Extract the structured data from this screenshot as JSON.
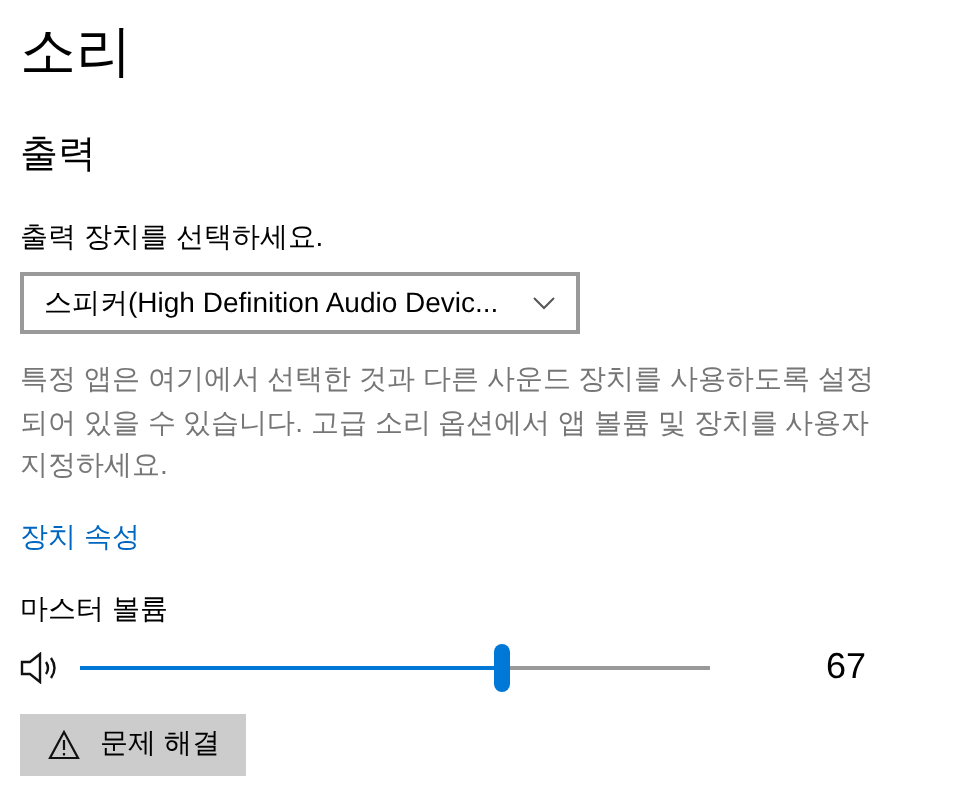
{
  "title": "소리",
  "section": "출력",
  "output_label": "출력 장치를 선택하세요.",
  "device_dropdown": {
    "value": "스피커(High Definition Audio Devic..."
  },
  "description": "특정 앱은 여기에서 선택한 것과 다른 사운드 장치를 사용하도록 설정 되어 있을 수 있습니다. 고급 소리 옵션에서 앱 볼륨 및 장치를 사용자 지정하세요.",
  "device_properties_link": "장치 속성",
  "master_volume": {
    "label": "마스터 볼륨",
    "level": 0.67,
    "reading": "67"
  },
  "troubleshoot_button": "문제 해결"
}
